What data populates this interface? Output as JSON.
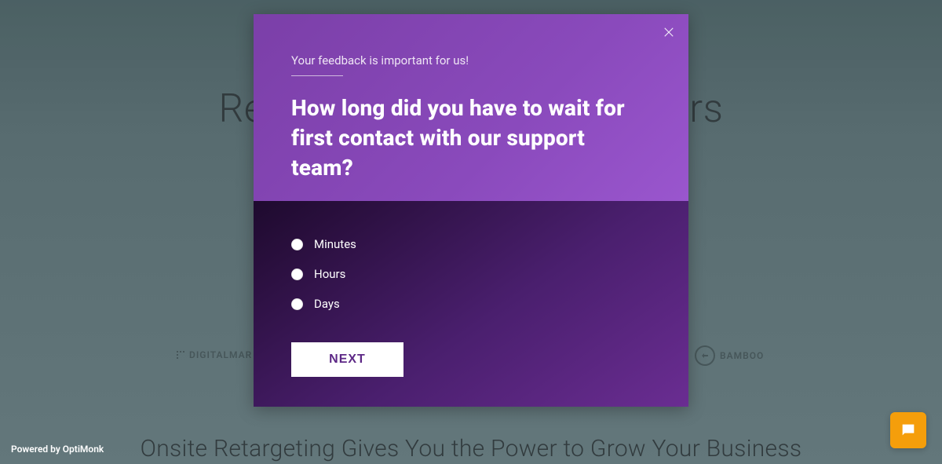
{
  "background": {
    "heading": "Recover Abandoning Visitors",
    "subheading": "Onsite Retargeting Gives You the Power to Grow Your Business",
    "logo_left": "DIGITALMAR",
    "logo_right": "BAMBOO"
  },
  "modal": {
    "intro": "Your feedback is important for us!",
    "question": "How long did you have to wait for first contact with our support team?",
    "options": [
      {
        "label": "Minutes"
      },
      {
        "label": "Hours"
      },
      {
        "label": "Days"
      }
    ],
    "next_button": "NEXT"
  },
  "footer": {
    "powered": "Powered by OptiMonk"
  },
  "colors": {
    "accent": "#8a4abc",
    "chat": "#f59e0b"
  }
}
